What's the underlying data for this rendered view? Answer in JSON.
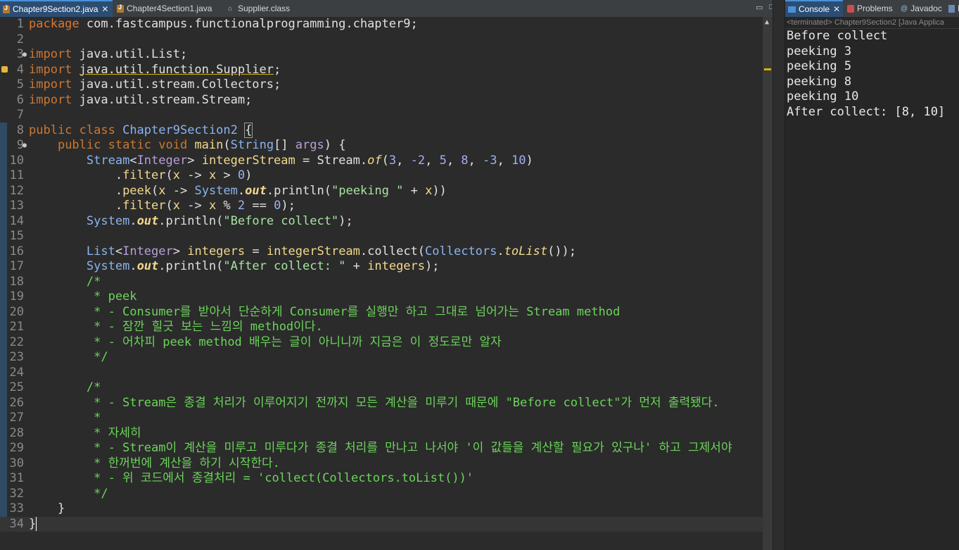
{
  "editor_tabs": [
    {
      "label": "Chapter9Section2.java",
      "active": true
    },
    {
      "label": "Chapter4Section1.java",
      "active": false
    },
    {
      "label": "Supplier.class",
      "active": false
    }
  ],
  "console_tabs": [
    {
      "label": "Console",
      "active": true
    },
    {
      "label": "Problems",
      "active": false
    },
    {
      "label": "Javadoc",
      "active": false
    },
    {
      "label": "D",
      "active": false
    }
  ],
  "console": {
    "status": "<terminated> Chapter9Section2 [Java Applica",
    "output": [
      "Before collect",
      "peeking 3",
      "peeking 5",
      "peeking 8",
      "peeking 10",
      "After collect: [8, 10]"
    ]
  },
  "code_lines": [
    "package com.fastcampus.functionalprogramming.chapter9;",
    "",
    "import java.util.List;",
    "import java.util.function.Supplier;",
    "import java.util.stream.Collectors;",
    "import java.util.stream.Stream;",
    "",
    "public class Chapter9Section2 {",
    "    public static void main(String[] args) {",
    "        Stream<Integer> integerStream = Stream.of(3, -2, 5, 8, -3, 10)",
    "            .filter(x -> x > 0)",
    "            .peek(x -> System.out.println(\"peeking \" + x))",
    "            .filter(x -> x % 2 == 0);",
    "        System.out.println(\"Before collect\");",
    "",
    "        List<Integer> integers = integerStream.collect(Collectors.toList());",
    "        System.out.println(\"After collect: \" + integers);",
    "        /*",
    "         * peek",
    "         * - Consumer를 받아서 단순하게 Consumer를 실행만 하고 그대로 넘어가는 Stream method",
    "         * - 잠깐 힐긋 보는 느낌의 method이다.",
    "         * - 어차피 peek method 배우는 글이 아니니까 지금은 이 정도로만 알자",
    "         */",
    "",
    "        /*",
    "         * - Stream은 종결 처리가 이루어지기 전까지 모든 계산을 미루기 때문에 \"Before collect\"가 먼저 출력됐다.",
    "         *",
    "         * 자세히",
    "         * - Stream이 계산을 미루고 미루다가 종결 처리를 만나고 나서야 '이 값들을 계산할 필요가 있구나' 하고 그제서야",
    "         * 한꺼번에 계산을 하기 시작한다.",
    "         * - 위 코드에서 종결처리 = 'collect(Collectors.toList())'",
    "         */",
    "    }",
    "}"
  ],
  "icons": {
    "java_file": "java-file-icon",
    "class_file": "class-file-icon",
    "console": "console-icon",
    "problems": "problems-icon",
    "javadoc": "javadoc-icon",
    "warning": "warning-icon"
  },
  "colors": {
    "editor_bg": "#2b2b2b",
    "keyword": "#cc7832",
    "string": "#a6e3a1",
    "comment": "#6bd45a",
    "number": "#9fb0f5",
    "type": "#8ab4ee",
    "active_tab": "#2b4d73"
  }
}
